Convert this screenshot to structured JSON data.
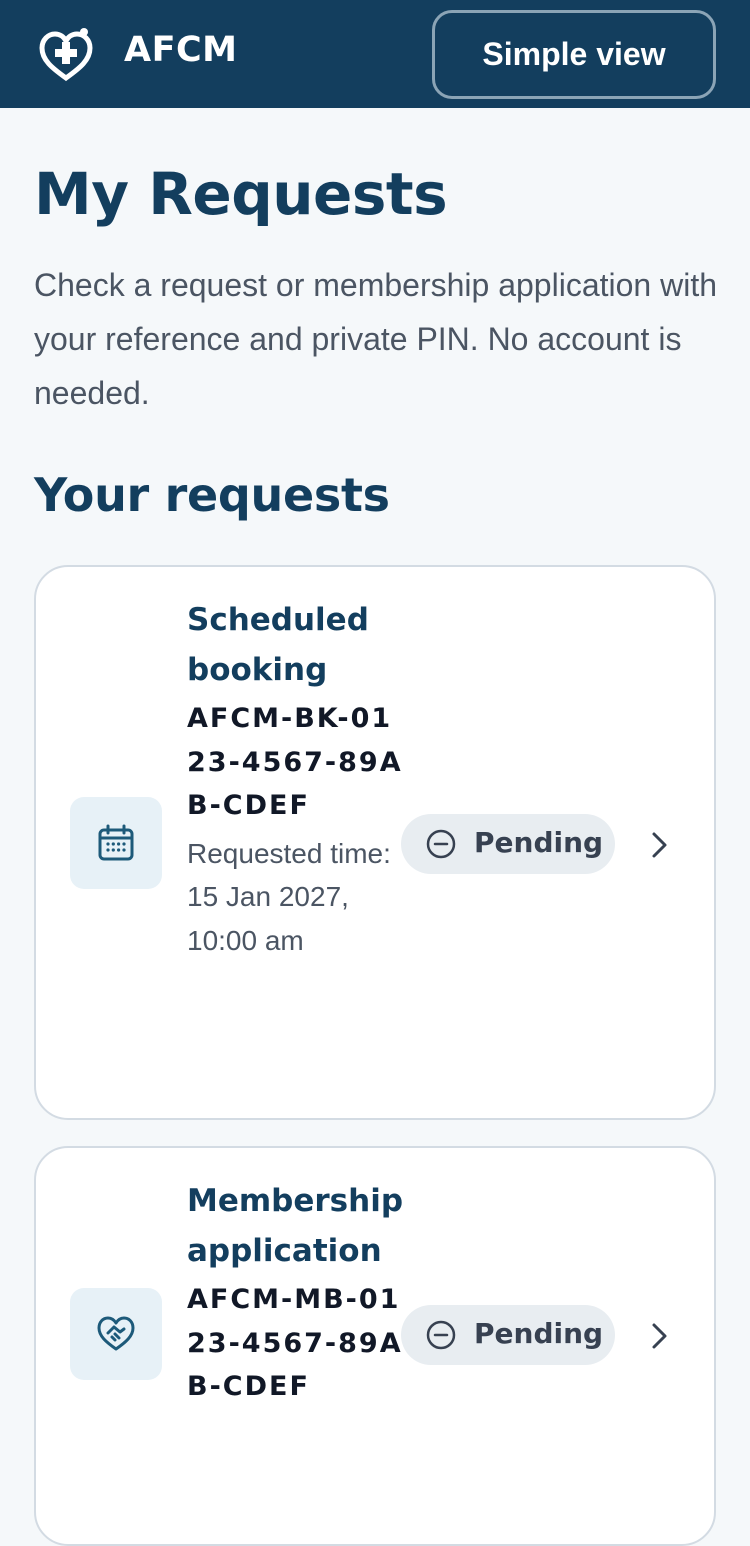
{
  "header": {
    "brand": "AFCM",
    "simple_view_label": "Simple view"
  },
  "page": {
    "title": "My Requests",
    "intro": "Check a request or membership application with your reference and private PIN. No account is needed.",
    "section_title": "Your requests"
  },
  "requests": [
    {
      "icon": "calendar-icon",
      "type": "Scheduled booking",
      "reference": "AFCM-BK-0123-4567-89AB-CDEF",
      "time": "Requested time: 15 Jan 2027, 10:00 am",
      "status": "Pending"
    },
    {
      "icon": "heart-handshake-icon",
      "type": "Membership application",
      "reference": "AFCM-MB-0123-4567-89AB-CDEF",
      "status": "Pending"
    }
  ],
  "colors": {
    "header_bg": "#133e5e",
    "primary_text": "#133e5e",
    "status_bg": "#e8edf1",
    "icon_bg": "#e7f1f7"
  }
}
